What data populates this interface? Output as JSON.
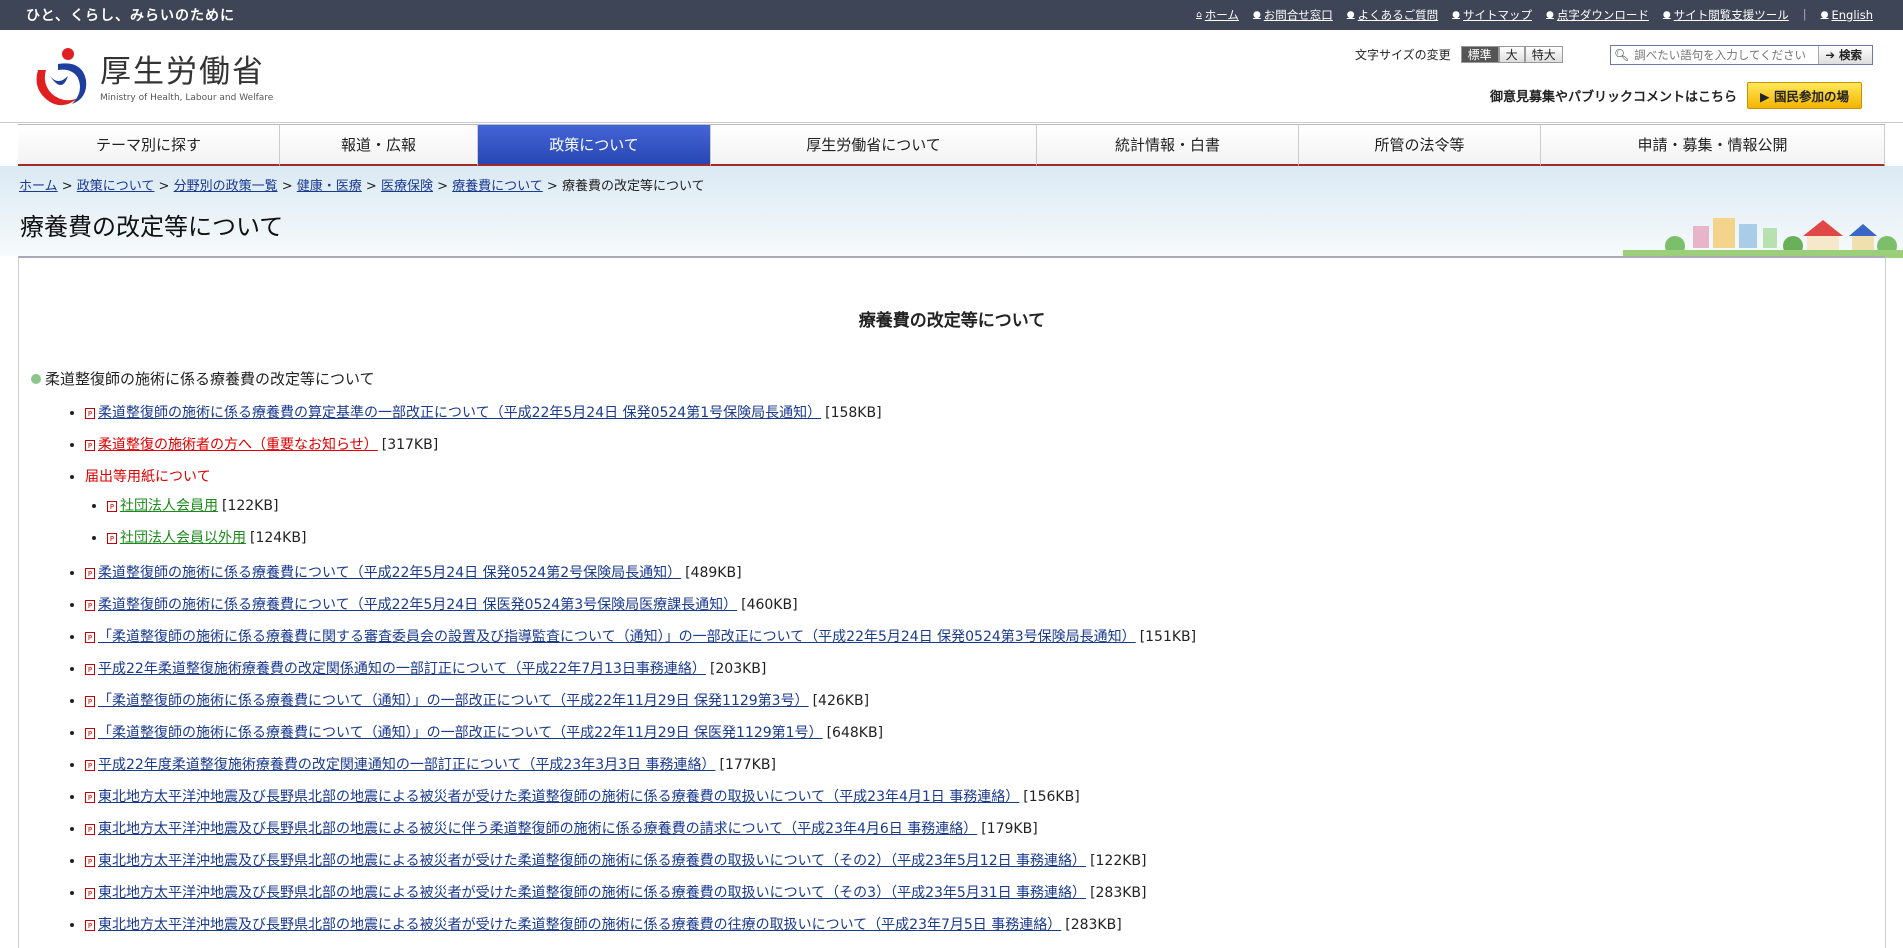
{
  "topbar": {
    "tagline": "ひと、くらし、みらいのために",
    "links": [
      "ホーム",
      "お問合せ窓口",
      "よくあるご質問",
      "サイトマップ",
      "点字ダウンロード",
      "サイト閲覧支援ツール",
      "English"
    ]
  },
  "header": {
    "logo_text": "厚生労働省",
    "logo_sub": "Ministry of Health, Labour and Welfare",
    "fontsize_label": "文字サイズの変更",
    "fontsize_options": [
      "標準",
      "大",
      "特大"
    ],
    "search_placeholder": "調べたい語句を入力してください",
    "search_button": "検索",
    "public_text": "御意見募集やパブリックコメントはこちら",
    "public_button": "国民参加の場"
  },
  "nav": [
    "テーマ別に探す",
    "報道・広報",
    "政策について",
    "厚生労働省について",
    "統計情報・白書",
    "所管の法令等",
    "申請・募集・情報公開"
  ],
  "breadcrumb": [
    "ホーム",
    "政策について",
    "分野別の政策一覧",
    "健康・医療",
    "医療保険",
    "療養費について",
    "療養費の改定等について"
  ],
  "page_title": "療養費の改定等について",
  "content": {
    "heading": "療養費の改定等について",
    "section_title": "柔道整復師の施術に係る療養費の改定等について",
    "docs": [
      {
        "title": "柔道整復師の施術に係る療養費の算定基準の一部改正について（平成22年5月24日 保発0524第1号保険局長通知）",
        "size": "[158KB]"
      },
      {
        "title": "柔道整復の施術者の方へ（重要なお知らせ）",
        "size": "[317KB]"
      },
      {
        "title": "届出等用紙について"
      },
      {
        "title": "社団法人会員用",
        "size": "[122KB]"
      },
      {
        "title": "社団法人会員以外用",
        "size": "[124KB]"
      },
      {
        "title": "柔道整復師の施術に係る療養費について（平成22年5月24日 保発0524第2号保険局長通知）",
        "size": "[489KB]"
      },
      {
        "title": "柔道整復師の施術に係る療養費について（平成22年5月24日 保医発0524第3号保険局医療課長通知）",
        "size": "[460KB]"
      },
      {
        "title": "「柔道整復師の施術に係る療養費に関する審査委員会の設置及び指導監査について（通知）」の一部改正について（平成22年5月24日 保発0524第3号保険局長通知）",
        "size": "[151KB]"
      },
      {
        "title": "平成22年柔道整復施術療養費の改定関係通知の一部訂正について（平成22年7月13日事務連絡）",
        "size": "[203KB]"
      },
      {
        "title": "「柔道整復師の施術に係る療養費について（通知）」の一部改正について（平成22年11月29日 保発1129第3号）",
        "size": "[426KB]"
      },
      {
        "title": "「柔道整復師の施術に係る療養費について（通知）」の一部改正について（平成22年11月29日 保医発1129第1号）",
        "size": "[648KB]"
      },
      {
        "title": "平成22年度柔道整復施術療養費の改定関連通知の一部訂正について（平成23年3月3日 事務連絡）",
        "size": "[177KB]"
      },
      {
        "title": "東北地方太平洋沖地震及び長野県北部の地震による被災者が受けた柔道整復師の施術に係る療養費の取扱いについて（平成23年4月1日 事務連絡）",
        "size": "[156KB]"
      },
      {
        "title": "東北地方太平洋沖地震及び長野県北部の地震による被災に伴う柔道整復師の施術に係る療養費の請求について（平成23年4月6日 事務連絡）",
        "size": "[179KB]"
      },
      {
        "title": "東北地方太平洋沖地震及び長野県北部の地震による被災者が受けた柔道整復師の施術に係る療養費の取扱いについて（その2）（平成23年5月12日 事務連絡）",
        "size": "[122KB]"
      },
      {
        "title": "東北地方太平洋沖地震及び長野県北部の地震による被災者が受けた柔道整復師の施術に係る療養費の取扱いについて（その3）（平成23年5月31日 事務連絡）",
        "size": "[283KB]"
      },
      {
        "title": "東北地方太平洋沖地震及び長野県北部の地震による被災者が受けた柔道整復師の施術に係る療養費の往療の取扱いについて（平成23年7月5日 事務連絡）",
        "size": "[283KB]"
      }
    ]
  },
  "colors": {
    "topbar": "#3d4556",
    "nav_selected": "#2f4fc0",
    "link": "#1a3a8f",
    "alert": "#e00000",
    "accent_green": "#1a8a1a"
  }
}
